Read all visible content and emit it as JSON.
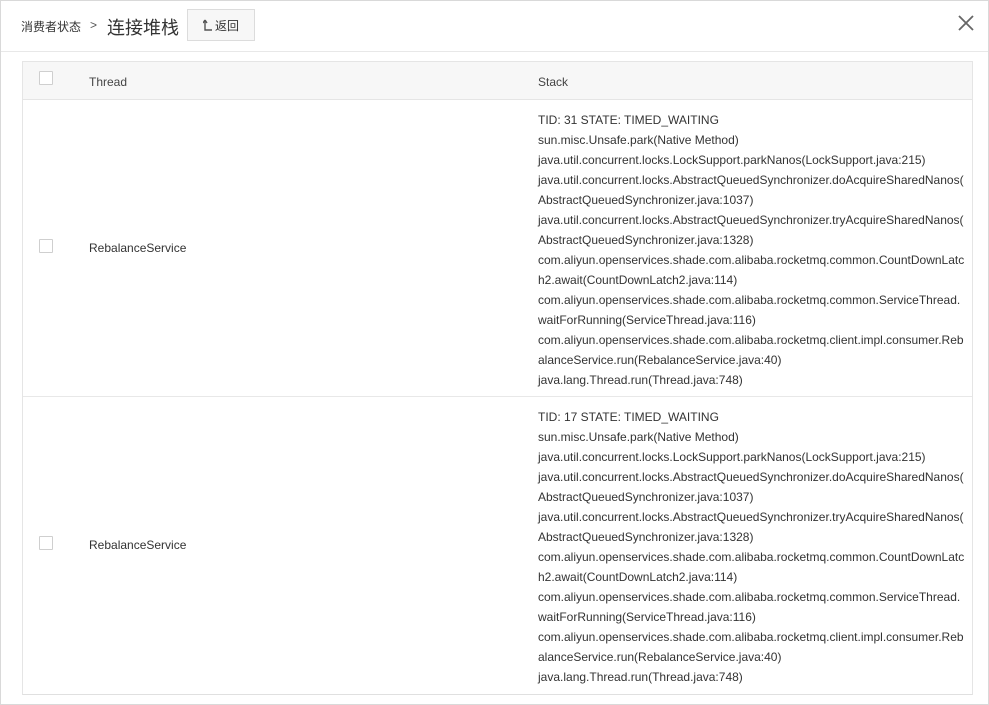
{
  "header": {
    "breadcrumb": "消费者状态",
    "separator": ">",
    "title": "连接堆栈",
    "back_label": "返回"
  },
  "table": {
    "columns": [
      "Thread",
      "Stack"
    ],
    "rows": [
      {
        "thread": "RebalanceService",
        "stack": [
          "TID: 31 STATE: TIMED_WAITING",
          "sun.misc.Unsafe.park(Native Method)",
          "java.util.concurrent.locks.LockSupport.parkNanos(LockSupport.java:215)",
          "java.util.concurrent.locks.AbstractQueuedSynchronizer.doAcquireSharedNanos(",
          "AbstractQueuedSynchronizer.java:1037)",
          "java.util.concurrent.locks.AbstractQueuedSynchronizer.tryAcquireSharedNanos(",
          "AbstractQueuedSynchronizer.java:1328)",
          "com.aliyun.openservices.shade.com.alibaba.rocketmq.common.CountDownLatc",
          "h2.await(CountDownLatch2.java:114)",
          "com.aliyun.openservices.shade.com.alibaba.rocketmq.common.ServiceThread.",
          "waitForRunning(ServiceThread.java:116)",
          "com.aliyun.openservices.shade.com.alibaba.rocketmq.client.impl.consumer.Reb",
          "alanceService.run(RebalanceService.java:40)",
          "java.lang.Thread.run(Thread.java:748)"
        ]
      },
      {
        "thread": "RebalanceService",
        "stack": [
          "TID: 17 STATE: TIMED_WAITING",
          "sun.misc.Unsafe.park(Native Method)",
          "java.util.concurrent.locks.LockSupport.parkNanos(LockSupport.java:215)",
          "java.util.concurrent.locks.AbstractQueuedSynchronizer.doAcquireSharedNanos(",
          "AbstractQueuedSynchronizer.java:1037)",
          "java.util.concurrent.locks.AbstractQueuedSynchronizer.tryAcquireSharedNanos(",
          "AbstractQueuedSynchronizer.java:1328)",
          "com.aliyun.openservices.shade.com.alibaba.rocketmq.common.CountDownLatc",
          "h2.await(CountDownLatch2.java:114)",
          "com.aliyun.openservices.shade.com.alibaba.rocketmq.common.ServiceThread.",
          "waitForRunning(ServiceThread.java:116)",
          "com.aliyun.openservices.shade.com.alibaba.rocketmq.client.impl.consumer.Reb",
          "alanceService.run(RebalanceService.java:40)",
          "java.lang.Thread.run(Thread.java:748)"
        ]
      }
    ]
  }
}
